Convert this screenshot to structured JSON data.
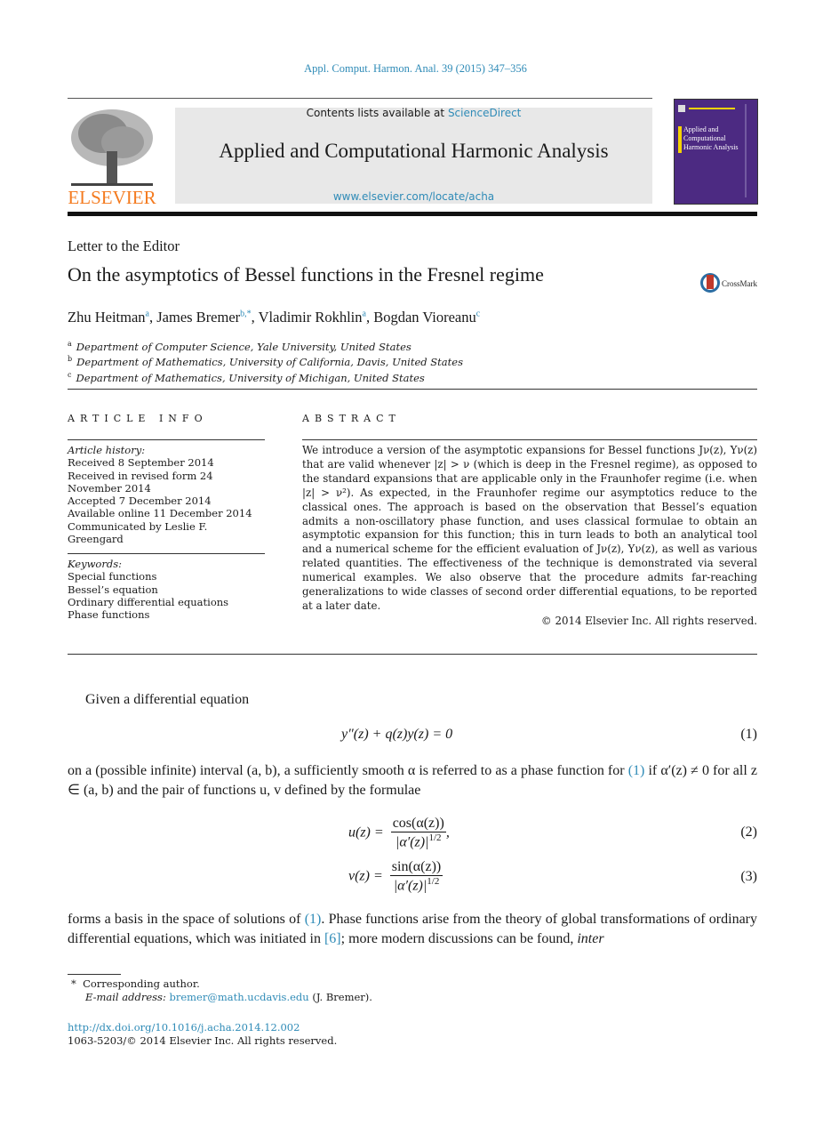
{
  "header": {
    "journal_ref": "Appl. Comput. Harmon. Anal. 39 (2015) 347–356",
    "contents_prefix": "Contents lists available at ",
    "contents_link": "ScienceDirect",
    "journal_title": "Applied and Computational Harmonic Analysis",
    "journal_url": "www.elsevier.com/locate/acha",
    "publisher_logo_text": "ELSEVIER",
    "cover_title": [
      "Applied and",
      "Computational",
      "Harmonic Analysis"
    ],
    "colors": {
      "link": "#2f8bb7",
      "elsevier_orange": "#f47b20",
      "cover_purple": "#4c2a82",
      "masthead_gray": "#e8e8e8"
    }
  },
  "article": {
    "type": "Letter to the Editor",
    "title": "On the asymptotics of Bessel functions in the Fresnel regime",
    "crossmark_label": "CrossMark",
    "authors": [
      {
        "name": "Zhu Heitman",
        "sup": "a"
      },
      {
        "name": "James Bremer",
        "sup": "b,*"
      },
      {
        "name": "Vladimir Rokhlin",
        "sup": "a"
      },
      {
        "name": "Bogdan Vioreanu",
        "sup": "c"
      }
    ],
    "affiliations": [
      {
        "key": "a",
        "text": "Department of Computer Science, Yale University, United States"
      },
      {
        "key": "b",
        "text": "Department of Mathematics, University of California, Davis, United States"
      },
      {
        "key": "c",
        "text": "Department of Mathematics, University of Michigan, United States"
      }
    ]
  },
  "article_info": {
    "heading": "ARTICLE INFO",
    "history_label": "Article history:",
    "history": [
      "Received 8 September 2014",
      "Received in revised form 24 November 2014",
      "Accepted 7 December 2014",
      "Available online 11 December 2014",
      "Communicated by Leslie F. Greengard"
    ],
    "keywords_label": "Keywords:",
    "keywords": [
      "Special functions",
      "Bessel’s equation",
      "Ordinary differential equations",
      "Phase functions"
    ]
  },
  "abstract": {
    "heading": "ABSTRACT",
    "text": "We introduce a version of the asymptotic expansions for Bessel functions Jν(z), Yν(z) that are valid whenever |z| > ν (which is deep in the Fresnel regime), as opposed to the standard expansions that are applicable only in the Fraunhofer regime (i.e. when |z| > ν²). As expected, in the Fraunhofer regime our asymptotics reduce to the classical ones. The approach is based on the observation that Bessel’s equation admits a non-oscillatory phase function, and uses classical formulae to obtain an asymptotic expansion for this function; this in turn leads to both an analytical tool and a numerical scheme for the efficient evaluation of Jν(z), Yν(z), as well as various related quantities. The effectiveness of the technique is demonstrated via several numerical examples. We also observe that the procedure admits far-reaching generalizations to wide classes of second order differential equations, to be reported at a later date.",
    "copyright": "© 2014 Elsevier Inc. All rights reserved."
  },
  "body": {
    "para1": "Given a differential equation",
    "eq1": "y″(z) + q(z)y(z) = 0",
    "eq1_num": "(1)",
    "para2_a": "on a (possible infinite) interval (a, b), a sufficiently smooth α is referred to as a phase function for ",
    "para2_ref": "(1)",
    "para2_b": " if α′(z) ≠ 0 for all z ∈ (a, b) and the pair of functions u, v defined by the formulae",
    "eq2_lhs": "u(z) =",
    "eq2_num_text": "cos(α(z))",
    "eq2_den_text": "|α′(z)|",
    "eq2_exp": "1/2",
    "eq2_tail": ",",
    "eq2_num": "(2)",
    "eq3_lhs": "v(z) =",
    "eq3_num_text": "sin(α(z))",
    "eq3_den_text": "|α′(z)|",
    "eq3_exp": "1/2",
    "eq3_num": "(3)",
    "para3_a": "forms a basis in the space of solutions of ",
    "para3_ref1": "(1)",
    "para3_b": ". Phase functions arise from the theory of global transformations of ordinary differential equations, which was initiated in ",
    "para3_ref2": "[6]",
    "para3_c": "; more modern discussions can be found, ",
    "para3_d": "inter"
  },
  "footer": {
    "star": "*",
    "corresponding": "Corresponding author.",
    "email_label": "E-mail address:",
    "email": "bremer@math.ucdavis.edu",
    "email_suffix": " (J. Bremer).",
    "doi": "http://dx.doi.org/10.1016/j.acha.2014.12.002",
    "issn": "1063-5203/© 2014 Elsevier Inc. All rights reserved."
  }
}
